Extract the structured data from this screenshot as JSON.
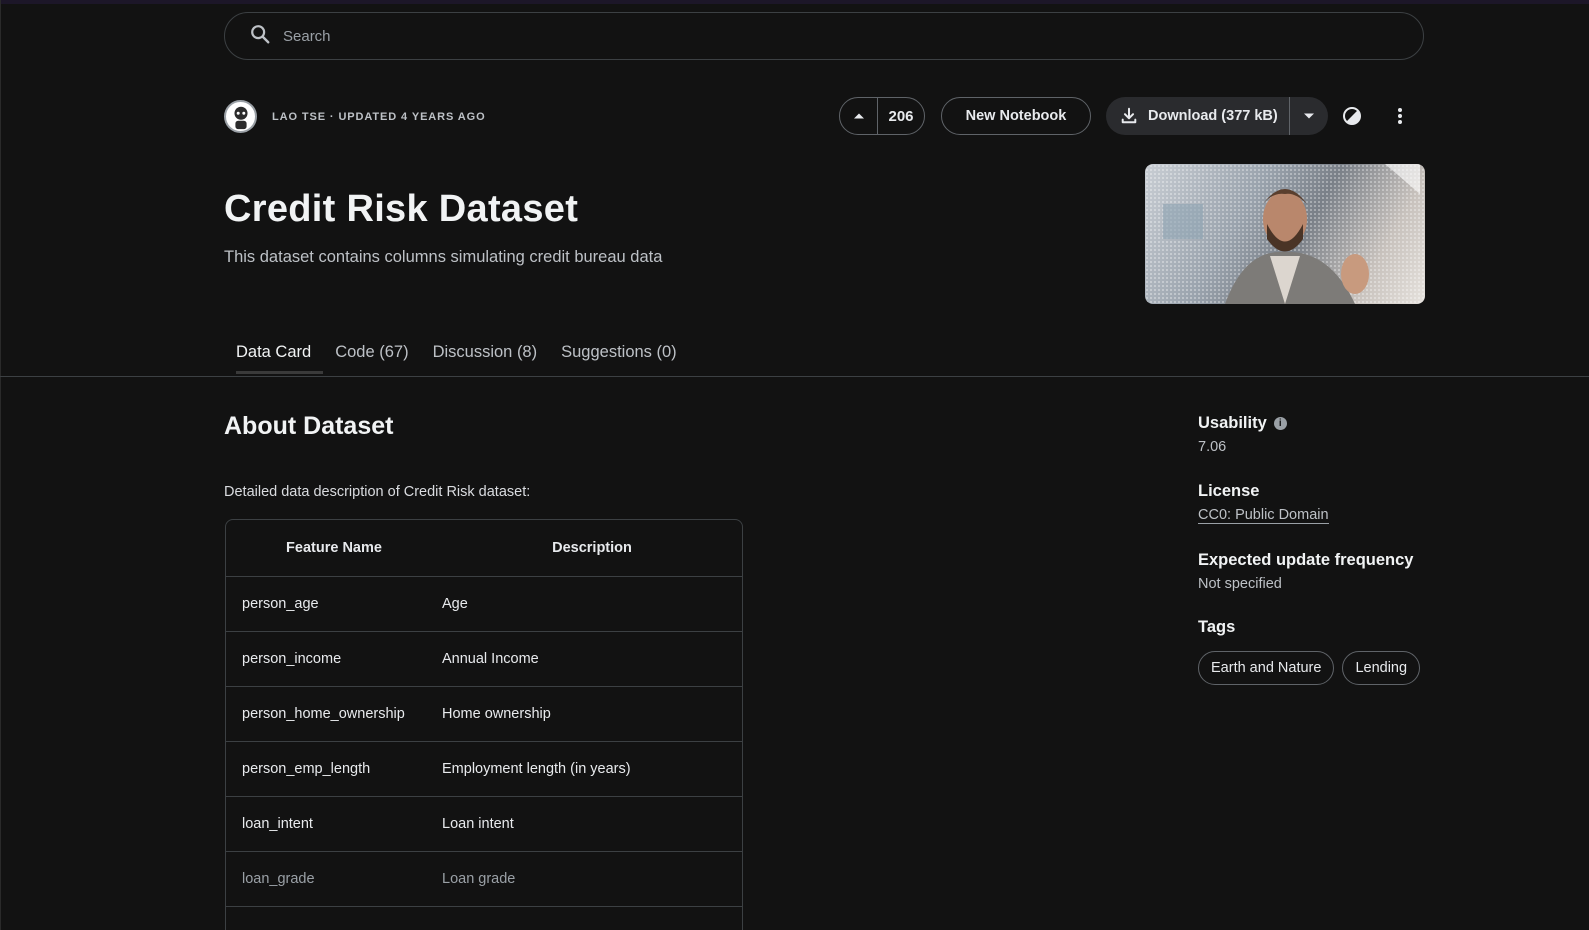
{
  "search": {
    "placeholder": "Search"
  },
  "header": {
    "owner_meta": "LAO TSE · UPDATED 4 YEARS AGO",
    "vote_count": "206",
    "new_notebook_label": "New Notebook",
    "download_label": "Download (377 kB)"
  },
  "dataset": {
    "title": "Credit Risk Dataset",
    "subtitle": "This dataset contains columns simulating credit bureau data"
  },
  "tabs": [
    {
      "label": "Data Card"
    },
    {
      "label": "Code (67)"
    },
    {
      "label": "Discussion (8)"
    },
    {
      "label": "Suggestions (0)"
    }
  ],
  "about": {
    "heading": "About Dataset",
    "intro": "Detailed data description of Credit Risk dataset:",
    "table": {
      "headers": [
        "Feature Name",
        "Description"
      ],
      "rows": [
        [
          "person_age",
          "Age"
        ],
        [
          "person_income",
          "Annual Income"
        ],
        [
          "person_home_ownership",
          "Home ownership"
        ],
        [
          "person_emp_length",
          "Employment length (in years)"
        ],
        [
          "loan_intent",
          "Loan intent"
        ],
        [
          "loan_grade",
          "Loan grade"
        ]
      ]
    }
  },
  "sidebar": {
    "usability_label": "Usability",
    "usability_value": "7.06",
    "license_label": "License",
    "license_value": "CC0: Public Domain",
    "frequency_label": "Expected update frequency",
    "frequency_value": "Not specified",
    "tags_label": "Tags",
    "tags": [
      "Earth and Nature",
      "Lending"
    ]
  },
  "colors": {
    "background": "#121212",
    "text": "#e8eaed",
    "muted": "#bdc1c6",
    "border": "#3c4043"
  },
  "icons": [
    "search-icon",
    "upvote-icon",
    "download-icon",
    "chevron-down-icon",
    "theme-icon",
    "more-vert-icon",
    "info-icon"
  ]
}
